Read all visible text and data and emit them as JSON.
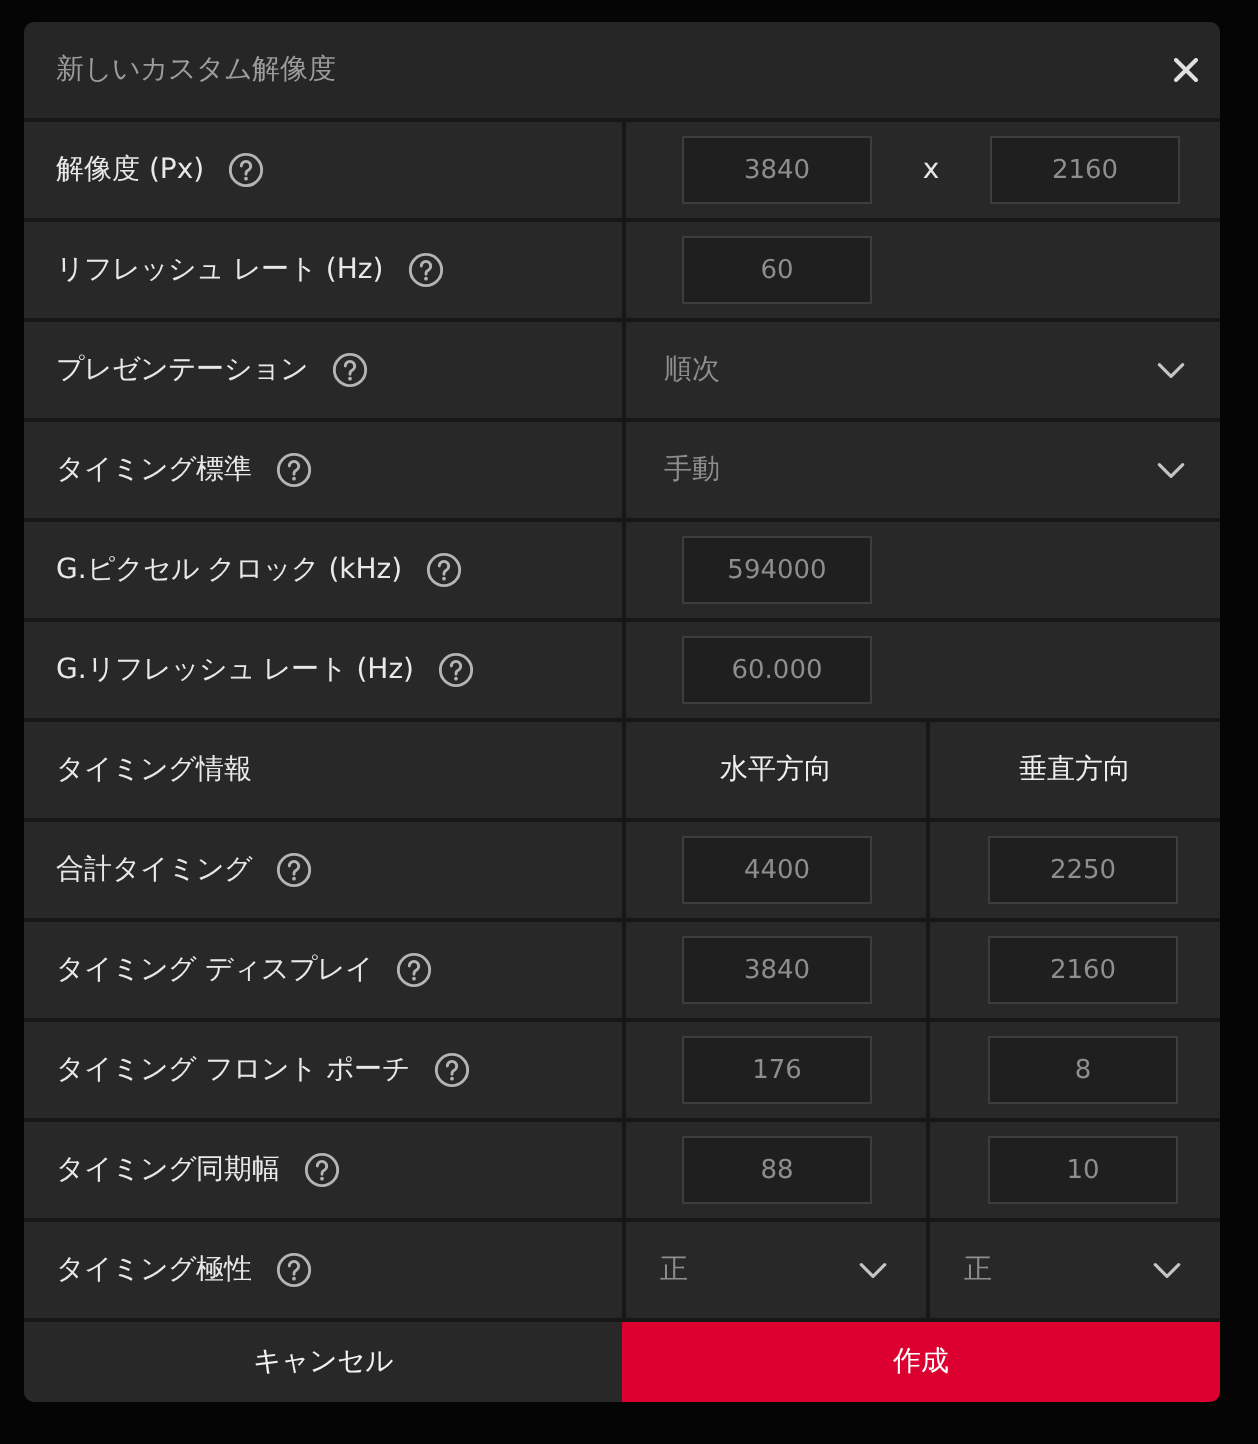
{
  "dialog": {
    "title": "新しいカスタム解像度"
  },
  "rows": [
    {
      "kind": "pair",
      "label": "解像度 (Px)",
      "values": [
        "3840",
        "2160"
      ],
      "separator": "x"
    },
    {
      "kind": "input",
      "label": "リフレッシュ レート (Hz)",
      "value": "60"
    },
    {
      "kind": "select",
      "label": "プレゼンテーション",
      "value": "順次"
    },
    {
      "kind": "select",
      "label": "タイミング標準",
      "value": "手動"
    },
    {
      "kind": "input",
      "label": "G.ピクセル クロック (kHz)",
      "value": "594000"
    },
    {
      "kind": "input",
      "label": "G.リフレッシュ レート (Hz)",
      "value": "60.000"
    },
    {
      "kind": "header",
      "label": "タイミング情報",
      "columns": [
        "水平方向",
        "垂直方向"
      ]
    },
    {
      "kind": "split",
      "label": "合計タイミング",
      "values": [
        "4400",
        "2250"
      ]
    },
    {
      "kind": "split",
      "label": "タイミング ディスプレイ",
      "values": [
        "3840",
        "2160"
      ]
    },
    {
      "kind": "split",
      "label": "タイミング フロント ポーチ",
      "values": [
        "176",
        "8"
      ]
    },
    {
      "kind": "split",
      "label": "タイミング同期幅",
      "values": [
        "88",
        "10"
      ]
    },
    {
      "kind": "split_select",
      "label": "タイミング極性",
      "values": [
        "正",
        "正"
      ]
    }
  ],
  "buttons": [
    {
      "kind": "secondary",
      "label": "キャンセル"
    },
    {
      "kind": "primary",
      "label": "作成"
    }
  ]
}
